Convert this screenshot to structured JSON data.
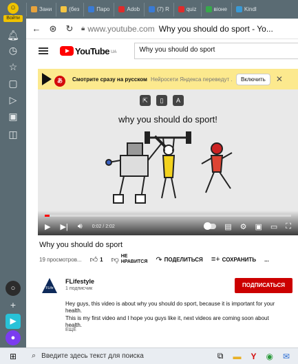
{
  "browser": {
    "sidebar": {
      "login_label": "Войти"
    },
    "tabs": [
      {
        "label": "Зани",
        "color": "#e8a33c"
      },
      {
        "label": "(без",
        "color": "#f5c542"
      },
      {
        "label": "Паро",
        "color": "#3a7bd5"
      },
      {
        "label": "Adob",
        "color": "#e02b2b"
      },
      {
        "label": "(7) R",
        "color": "#3a7bd5"
      },
      {
        "label": "quiz",
        "color": "#e02b2b"
      },
      {
        "label": "віоне",
        "color": "#37a84b"
      },
      {
        "label": "Kindl",
        "color": "#3a9ad5"
      }
    ],
    "address": {
      "host": "www.youtube.com",
      "title": "Why you should do sport - Yo..."
    }
  },
  "youtube": {
    "logo_text": "YouTube",
    "region": "UA",
    "search_value": "Why you should do sport",
    "translate_banner": {
      "strong": "Смотрите сразу на русском",
      "sub": "Нейросети Яндекса переведут ...",
      "button": "Включить"
    },
    "frame_title": "why you should do sport!",
    "player": {
      "time": "0:02 / 2:02",
      "progress_fraction": 0.02
    },
    "video_title": "Why you should do sport",
    "views": "19 просмотров...",
    "likes": "1",
    "dislike_line1": "НЕ",
    "dislike_line2": "НРАВИТСЯ",
    "share": "ПОДЕЛИТЬСЯ",
    "save": "СОХРАНИТЬ",
    "more": "...",
    "channel": {
      "name": "FLifestyle",
      "subscribers": "1 подписчик",
      "logo_text": "FLife",
      "subscribe": "ПОДПИСАТЬСЯ"
    },
    "description": [
      "Hey guys, this video is about why you should do sport, because it is important for your health.",
      "This is my first video and I hope you guys like it, next videos are coming soon about health."
    ],
    "show_more": "ЕЩЁ"
  },
  "taskbar": {
    "search_placeholder": "Введите здесь текст для поиска"
  }
}
